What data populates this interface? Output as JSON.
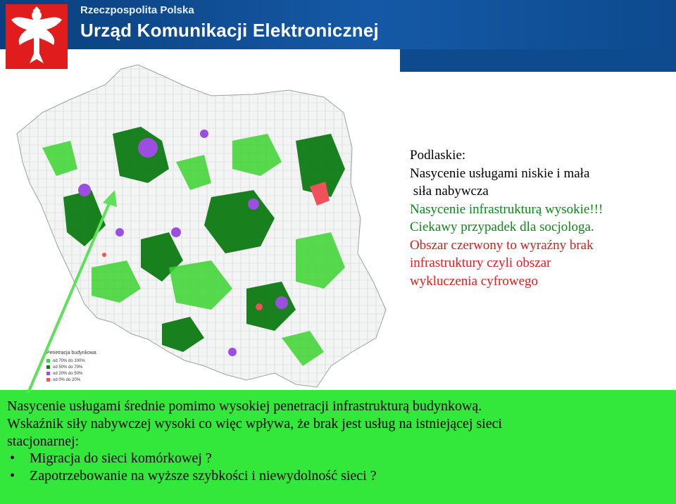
{
  "header": {
    "org_line1": "Rzeczpospolita Polska",
    "org_line2": "Urząd Komunikacji Elektronicznej",
    "logo": "polish-eagle-emblem"
  },
  "side_text": {
    "title": "Podlaskie:",
    "line1": "Nasycenie usługami niskie i mała",
    "line2": " siła nabywcza",
    "line3": "Nasycenie infrastrukturą wysokie!!!",
    "line4": "Ciekawy przypadek dla socjologa.",
    "line5": "Obszar czerwony to wyraźny brak",
    "line6": "infrastruktury czyli obszar",
    "line7": "wykluczenia cyfrowego"
  },
  "legend": {
    "title": "Penetracja budynkowa",
    "items": [
      {
        "label": "od 70% do 100%",
        "color": "#3bd32f"
      },
      {
        "label": "od 50% do 70%",
        "color": "#0d7a12"
      },
      {
        "label": "od 20% do 50%",
        "color": "#9b4ee0"
      },
      {
        "label": "od 0% do 20%",
        "color": "#f0505a"
      }
    ]
  },
  "bottom_text": {
    "line1": "Nasycenie usługami średnie pomimo wysokiej penetracji infrastrukturą budynkową.",
    "line2": "Wskaźnik siły nabywczej wysoki co więc wpływa, że brak jest usług na istniejącej sieci",
    "line3": "stacjonarnej:",
    "bullets": [
      "Migracja do sieci komórkowej ?",
      "Zapotrzebowanie na wyższe szybkości i niewydolność sieci ?"
    ]
  },
  "colors": {
    "header_blue": "#0d4a8e",
    "bottom_green": "#33e83a",
    "highlight_green": "#0a8a14",
    "highlight_red": "#e31a1a",
    "arrow_green": "#5de05a"
  }
}
